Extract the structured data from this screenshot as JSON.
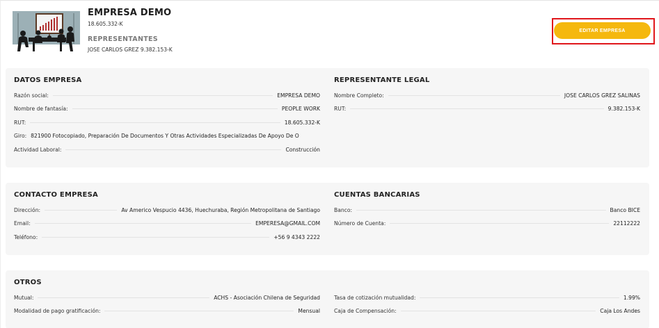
{
  "header": {
    "company_name": "EMPRESA DEMO",
    "company_rut": "18.605.332-K",
    "representatives_title": "REPRESENTANTES",
    "representatives_value": "JOSE CARLOS GREZ 9.382.153-K",
    "edit_button_label": "EDITAR EMPRESA"
  },
  "colors": {
    "accent": "#f5b80e",
    "highlight": "#e0161b",
    "card_background": "#f6f6f6"
  },
  "datos_empresa": {
    "title": "DATOS EMPRESA",
    "rows": [
      {
        "label": "Razón social:",
        "value": "EMPRESA DEMO"
      },
      {
        "label": "Nombre de fantasía:",
        "value": "PEOPLE WORK"
      },
      {
        "label": "RUT:",
        "value": "18.605.332-K"
      },
      {
        "label": "Giro:",
        "value": "821900 Fotocopiado, Preparación De Documentos Y Otras Actividades Especializadas De Apoyo De O"
      },
      {
        "label": "Actividad Laboral:",
        "value": "Construcción"
      }
    ]
  },
  "representante_legal": {
    "title": "REPRESENTANTE LEGAL",
    "rows": [
      {
        "label": "Nombre Completo:",
        "value": "JOSE CARLOS GREZ SALINAS"
      },
      {
        "label": "RUT:",
        "value": "9.382.153-K"
      }
    ]
  },
  "contacto_empresa": {
    "title": "CONTACTO EMPRESA",
    "rows": [
      {
        "label": "Dirección:",
        "value": "Av Americo Vespucio 4436, Huechuraba, Región Metropolitana de Santiago"
      },
      {
        "label": "Email:",
        "value": "EMPERESA@GMAIL.COM"
      },
      {
        "label": "Teléfono:",
        "value": "+56 9 4343 2222"
      }
    ]
  },
  "cuentas_bancarias": {
    "title": "CUENTAS BANCARIAS",
    "rows": [
      {
        "label": "Banco:",
        "value": "Banco BICE"
      },
      {
        "label": "Número de Cuenta:",
        "value": "22112222"
      }
    ]
  },
  "otros": {
    "title": "OTROS",
    "left_rows": [
      {
        "label": "Mutual:",
        "value": "ACHS - Asociación Chilena de Seguridad"
      },
      {
        "label": "Modalidad de pago gratificación:",
        "value": "Mensual"
      }
    ],
    "right_rows": [
      {
        "label": "Tasa de cotización mutualidad:",
        "value": "1.99%"
      },
      {
        "label": "Caja de Compensación:",
        "value": "Caja Los Andes"
      }
    ]
  },
  "icons": {
    "logo": "meeting-presentation-illustration"
  }
}
